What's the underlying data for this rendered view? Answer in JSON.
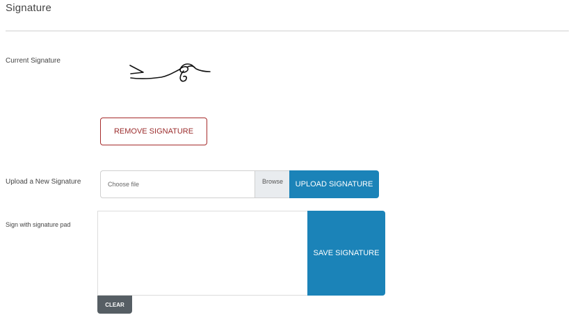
{
  "page": {
    "title": "Signature"
  },
  "current_signature": {
    "label": "Current Signature",
    "image_name": "handwritten-signature-image"
  },
  "remove": {
    "label": "REMOVE SIGNATURE"
  },
  "upload": {
    "label": "Upload a New Signature",
    "file_placeholder": "Choose file",
    "browse_label": "Browse",
    "button_label": "UPLOAD SIGNATURE"
  },
  "pad": {
    "label": "Sign with signature pad",
    "save_label": "SAVE SIGNATURE",
    "clear_label": "CLEAR"
  },
  "colors": {
    "primary": "#1b83b8",
    "danger": "#9b2c2c",
    "secondary": "#565e64"
  }
}
